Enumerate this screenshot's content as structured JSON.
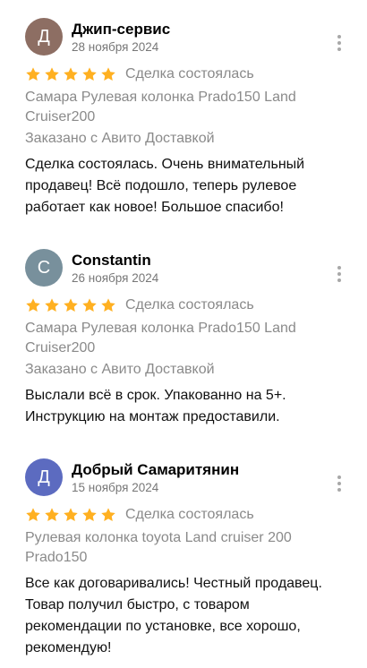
{
  "reviews": [
    {
      "avatar_letter": "Д",
      "avatar_color": "#8d6e63",
      "author": "Джип-сервис",
      "date": "28 ноября 2024",
      "rating": 5,
      "deal_status": "Сделка состоялась",
      "item": "Самара Рулевая колонка Prado150 Land Cruiser200",
      "delivery": "Заказано с Авито Доставкой",
      "text": "Сделка состоялась. Очень внимательный продавец! Всё подошло, теперь рулевое работает как новое! Большое спасибо!",
      "more_icon": "more-vertical-icon"
    },
    {
      "avatar_letter": "C",
      "avatar_color": "#78909c",
      "author": "Constantin",
      "date": "26 ноября 2024",
      "rating": 5,
      "deal_status": "Сделка состоялась",
      "item": "Самара Рулевая колонка Prado150 Land Cruiser200",
      "delivery": "Заказано с Авито Доставкой",
      "text": "Выслали всё в срок. Упакованно на 5+. Инструкцию на монтаж предоставили.",
      "more_icon": "more-vertical-icon"
    },
    {
      "avatar_letter": "Д",
      "avatar_color": "#5c6bc0",
      "author": "Добрый Самаритянин",
      "date": "15 ноября 2024",
      "rating": 5,
      "deal_status": "Сделка состоялась",
      "item": "Рулевая колонка toyota Land cruiser 200 Prado150",
      "text": "Все как договаривались! Честный продавец. Товар получил быстро, с товаром рекомендации по установке, все хорошо, рекомендую!",
      "more_icon": "more-vertical-icon"
    }
  ],
  "star_color": "#ffb021"
}
